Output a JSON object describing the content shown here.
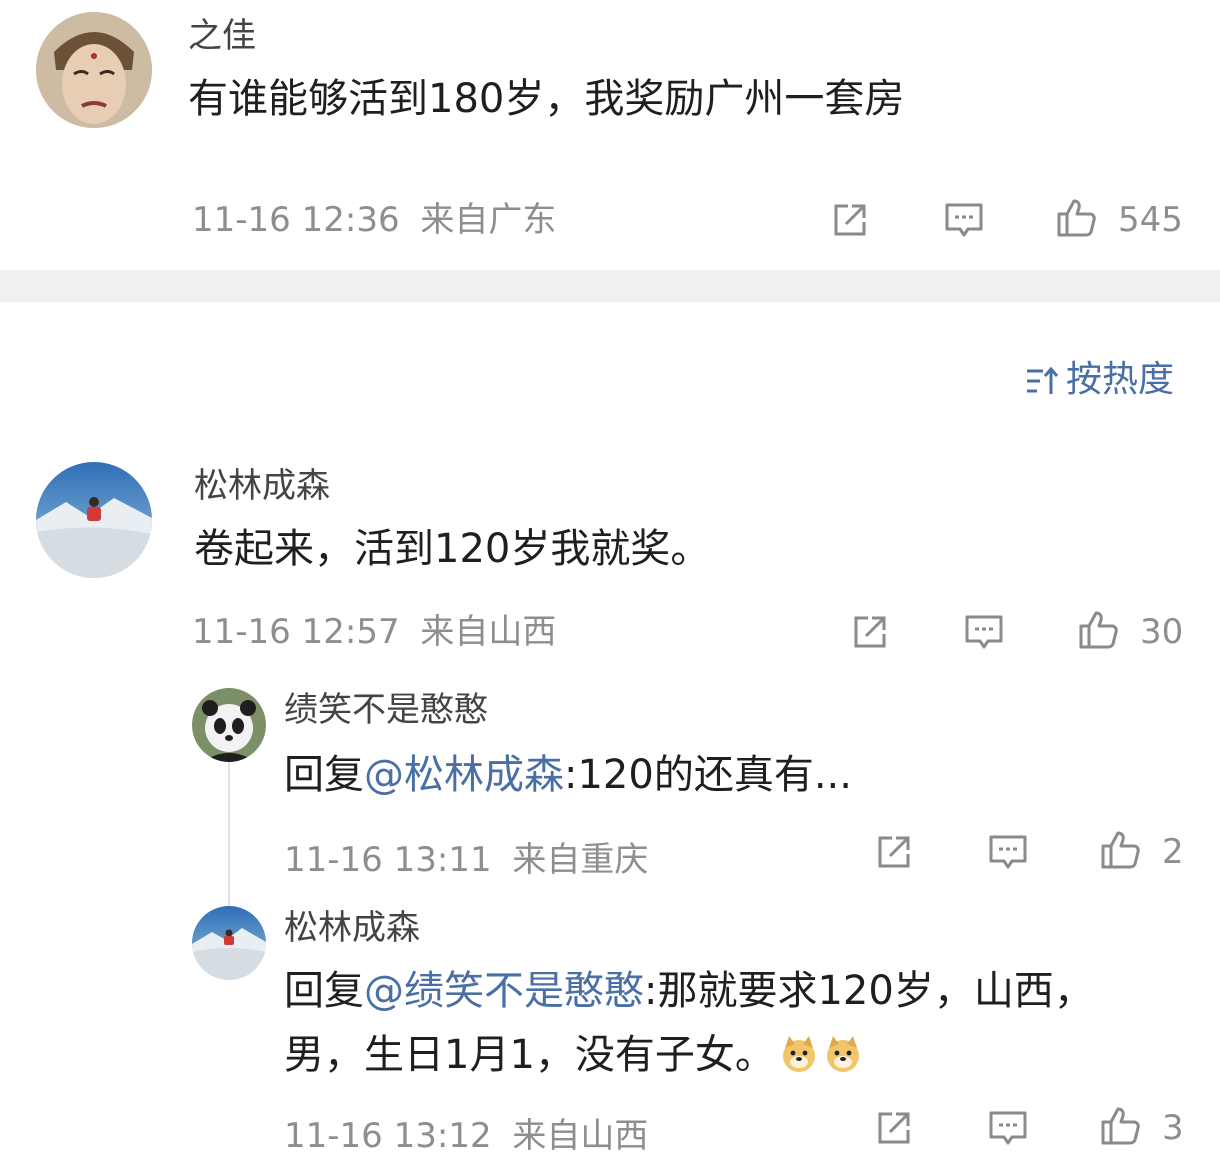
{
  "top_comment": {
    "author": "之佳",
    "text": "有谁能够活到180岁，我奖励广州一套房",
    "time": "11-16 12:36",
    "location": "来自广东",
    "likes": "545"
  },
  "sort": {
    "label": "按热度"
  },
  "comments": [
    {
      "author": "松林成森",
      "text": "卷起来，活到120岁我就奖。",
      "time": "11-16 12:57",
      "location": "来自山西",
      "likes": "30"
    }
  ],
  "replies": [
    {
      "author": "绩笑不是憨憨",
      "reply_prefix": "回复",
      "mention": "@松林成森",
      "text": ":120的还真有...",
      "time": "11-16 13:11",
      "location": "来自重庆",
      "likes": "2"
    },
    {
      "author": "松林成森",
      "reply_prefix": "回复",
      "mention": "@绩笑不是憨憨",
      "text_line1": ":那就要求120岁，山西，",
      "text_line2": "男，生日1月1，没有子女。",
      "time": "11-16 13:12",
      "location": "来自山西",
      "likes": "3"
    }
  ],
  "colors": {
    "link": "#4a6fa5",
    "meta": "#8e8e8e",
    "divider": "#f0f0f0"
  }
}
